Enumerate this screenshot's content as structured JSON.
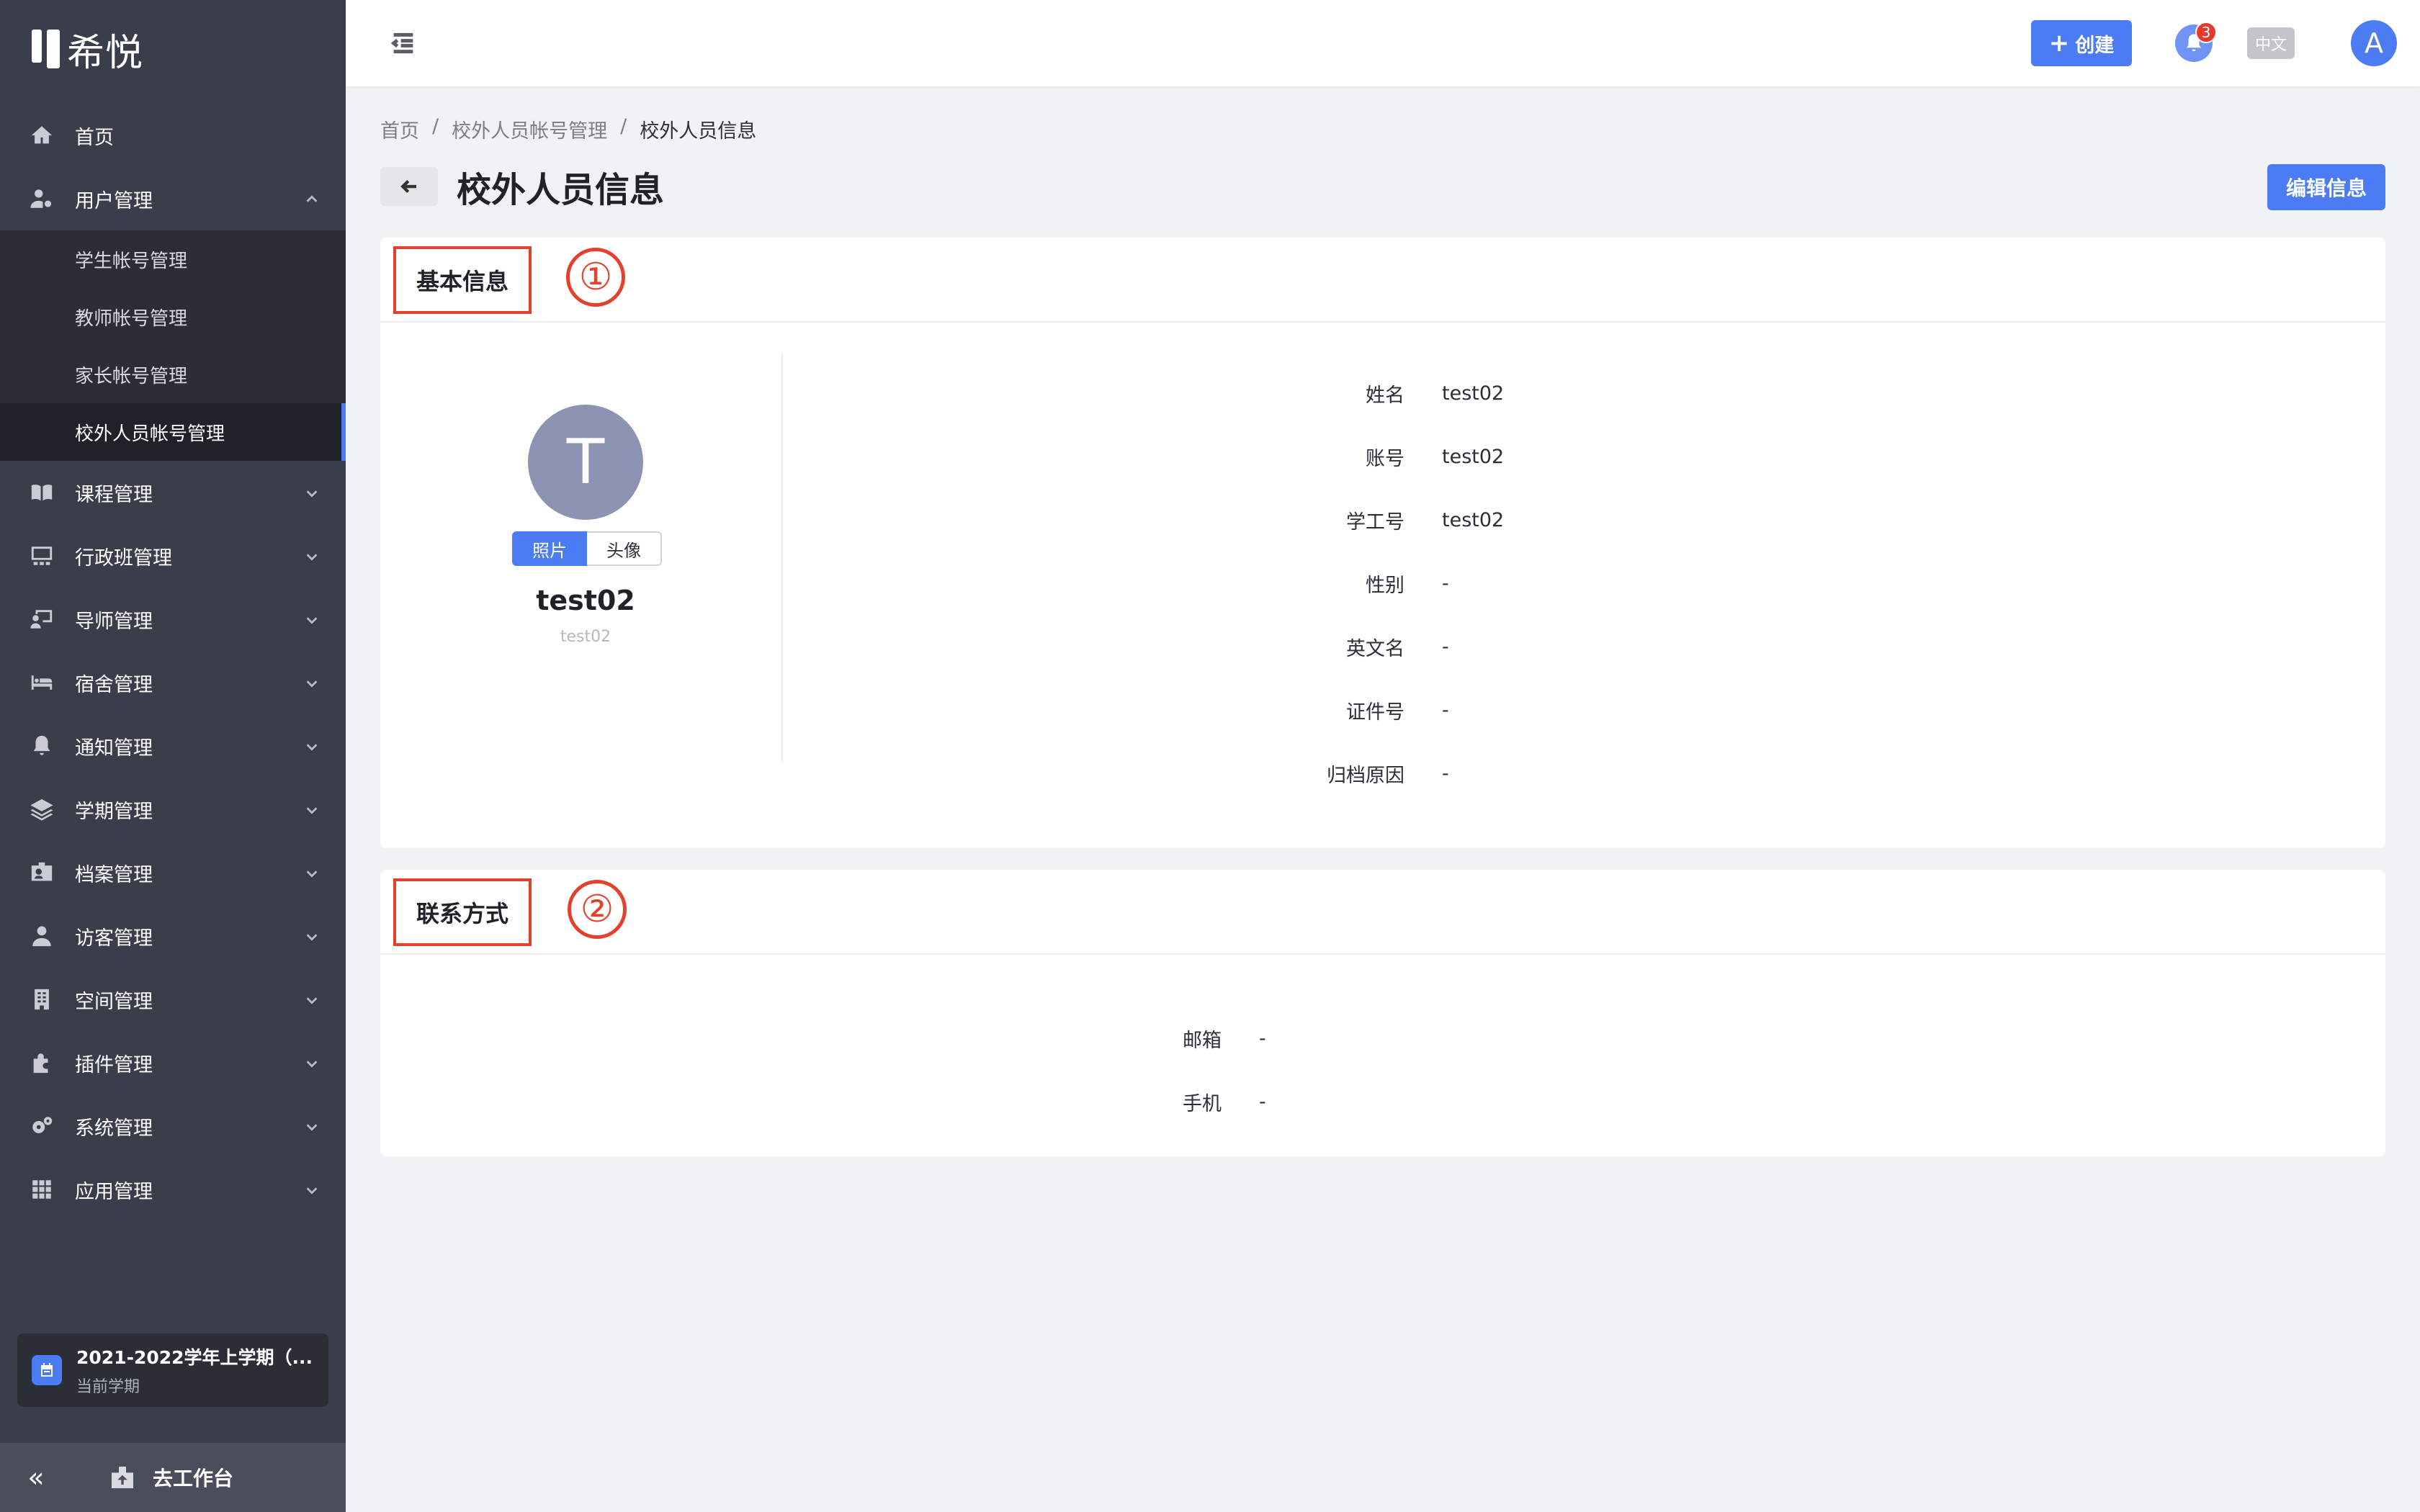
{
  "app": {
    "logo_text": "希悦"
  },
  "sidebar": {
    "items": [
      {
        "label": "首页",
        "icon": "home-icon"
      },
      {
        "label": "用户管理",
        "icon": "user-settings-icon",
        "expanded": true
      },
      {
        "label": "课程管理",
        "icon": "book-icon"
      },
      {
        "label": "行政班管理",
        "icon": "classroom-icon"
      },
      {
        "label": "导师管理",
        "icon": "mentor-icon"
      },
      {
        "label": "宿舍管理",
        "icon": "bed-icon"
      },
      {
        "label": "通知管理",
        "icon": "bell-icon"
      },
      {
        "label": "学期管理",
        "icon": "layers-icon"
      },
      {
        "label": "档案管理",
        "icon": "id-card-icon"
      },
      {
        "label": "访客管理",
        "icon": "visitor-icon"
      },
      {
        "label": "空间管理",
        "icon": "building-icon"
      },
      {
        "label": "插件管理",
        "icon": "puzzle-icon"
      },
      {
        "label": "系统管理",
        "icon": "gears-icon"
      },
      {
        "label": "应用管理",
        "icon": "grid-icon"
      }
    ],
    "user_submenu": [
      "学生帐号管理",
      "教师帐号管理",
      "家长帐号管理",
      "校外人员帐号管理"
    ],
    "active_submenu": "校外人员帐号管理",
    "term": {
      "title": "2021-2022学年上学期（...",
      "subtitle": "当前学期"
    },
    "collapse_label": "«",
    "workbench_label": "去工作台"
  },
  "header": {
    "create_label": "创建",
    "create_plus": "+",
    "notification_count": "3",
    "language": "中文",
    "avatar_letter": "A"
  },
  "breadcrumb": [
    "首页",
    "/",
    "校外人员帐号管理",
    "/",
    "校外人员信息"
  ],
  "page": {
    "title": "校外人员信息",
    "edit_label": "编辑信息"
  },
  "basic": {
    "title": "基本信息",
    "number": "①",
    "avatar_letter": "T",
    "photo_tab": "照片",
    "avatar_tab": "头像",
    "name": "test02",
    "username": "test02",
    "fields": [
      {
        "label": "姓名",
        "value": "test02"
      },
      {
        "label": "账号",
        "value": "test02"
      },
      {
        "label": "学工号",
        "value": "test02"
      },
      {
        "label": "性别",
        "value": "-"
      },
      {
        "label": "英文名",
        "value": "-"
      },
      {
        "label": "证件号",
        "value": "-"
      },
      {
        "label": "归档原因",
        "value": "-"
      }
    ]
  },
  "contact": {
    "title": "联系方式",
    "number": "②",
    "fields": [
      {
        "label": "邮箱",
        "value": "-"
      },
      {
        "label": "手机",
        "value": "-"
      }
    ]
  },
  "colors": {
    "accent": "#4c7cf3",
    "sidebar": "#3a3e4a",
    "highlight_red": "#e5402c"
  }
}
